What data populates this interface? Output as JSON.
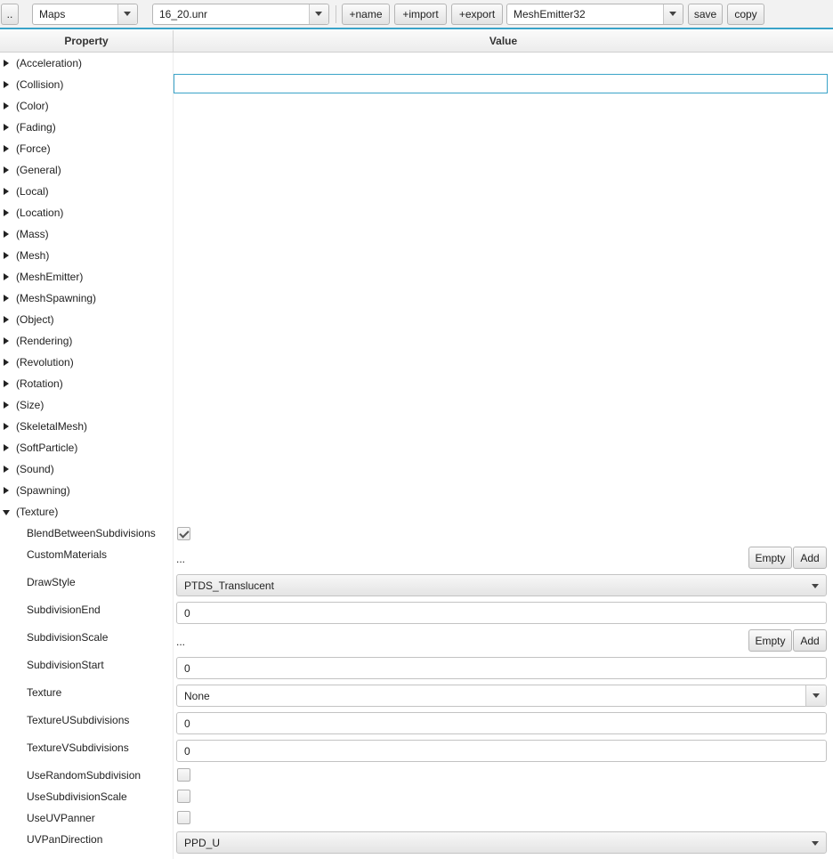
{
  "toolbar": {
    "up_label": "..",
    "category": "Maps",
    "file": "16_20.unr",
    "add_name_label": "+name",
    "add_import_label": "+import",
    "add_export_label": "+export",
    "object": "MeshEmitter32",
    "save_label": "save",
    "copy_label": "copy"
  },
  "table": {
    "property_header": "Property",
    "value_header": "Value"
  },
  "groups": [
    "(Acceleration)",
    "(Collision)",
    "(Color)",
    "(Fading)",
    "(Force)",
    "(General)",
    "(Local)",
    "(Location)",
    "(Mass)",
    "(Mesh)",
    "(MeshEmitter)",
    "(MeshSpawning)",
    "(Object)",
    "(Rendering)",
    "(Revolution)",
    "(Rotation)",
    "(Size)",
    "(SkeletalMesh)",
    "(SoftParticle)",
    "(Sound)",
    "(Spawning)"
  ],
  "texture_group": "(Texture)",
  "texture_props": {
    "blend_between": {
      "label": "BlendBetweenSubdivisions",
      "checked": true
    },
    "custom_materials": {
      "label": "CustomMaterials",
      "value": "...",
      "empty_label": "Empty",
      "add_label": "Add"
    },
    "draw_style": {
      "label": "DrawStyle",
      "value": "PTDS_Translucent"
    },
    "subdivision_end": {
      "label": "SubdivisionEnd",
      "value": "0"
    },
    "subdivision_scale": {
      "label": "SubdivisionScale",
      "value": "...",
      "empty_label": "Empty",
      "add_label": "Add"
    },
    "subdivision_start": {
      "label": "SubdivisionStart",
      "value": "0"
    },
    "texture": {
      "label": "Texture",
      "value": "None"
    },
    "texture_u_subdivisions": {
      "label": "TextureUSubdivisions",
      "value": "0"
    },
    "texture_v_subdivisions": {
      "label": "TextureVSubdivisions",
      "value": "0"
    },
    "use_random_subdivision": {
      "label": "UseRandomSubdivision",
      "checked": false
    },
    "use_subdivision_scale": {
      "label": "UseSubdivisionScale",
      "checked": false
    },
    "use_uv_panner": {
      "label": "UseUVPanner",
      "checked": false
    },
    "uv_pan_direction": {
      "label": "UVPanDirection",
      "value": "PPD_U"
    }
  }
}
